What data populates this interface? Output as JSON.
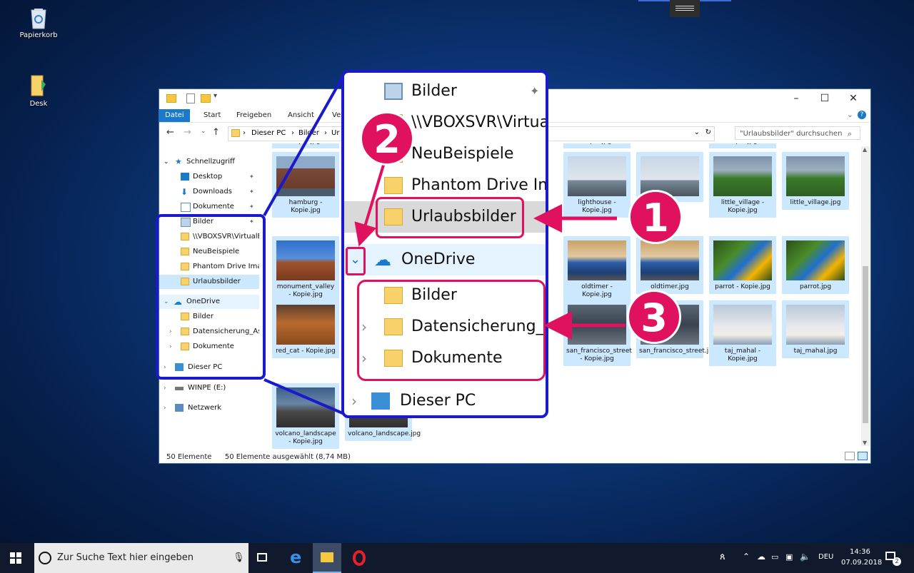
{
  "desktop": {
    "icons": [
      {
        "label": "Papierkorb"
      },
      {
        "label": "Desk"
      }
    ]
  },
  "explorer": {
    "ribbon_tabs": [
      "Datei",
      "Start",
      "Freigeben",
      "Ansicht",
      "Ve"
    ],
    "breadcrumb": [
      "Dieser PC",
      "Bilder",
      "Ur"
    ],
    "search_placeholder": "\"Urlaubsbilder\" durchsuchen",
    "nav": [
      {
        "label": "Schnellzugriff",
        "icon": "star-icon"
      },
      {
        "label": "Desktop",
        "icon": "desktop-icon",
        "pinned": true
      },
      {
        "label": "Downloads",
        "icon": "download-arrow-icon",
        "pinned": true
      },
      {
        "label": "Dokumente",
        "icon": "document-icon",
        "pinned": true
      },
      {
        "label": "Bilder",
        "icon": "pictures-icon",
        "pinned": true
      },
      {
        "label": "\\\\VBOXSVR\\VirtualE",
        "icon": "network-folder-icon"
      },
      {
        "label": "NeuBeispiele",
        "icon": "folder-icon"
      },
      {
        "label": "Phantom Drive Ima",
        "icon": "folder-icon"
      },
      {
        "label": "Urlaubsbilder",
        "icon": "folder-icon",
        "selected": true
      },
      {
        "label": "OneDrive",
        "icon": "cloud-icon"
      },
      {
        "label": "Bilder",
        "icon": "folder-icon"
      },
      {
        "label": "Datensicherung_Ash",
        "icon": "folder-icon"
      },
      {
        "label": "Dokumente",
        "icon": "folder-icon"
      },
      {
        "label": "Dieser PC",
        "icon": "computer-icon"
      },
      {
        "label": "WINPE (E:)",
        "icon": "drive-icon"
      },
      {
        "label": "Netzwerk",
        "icon": "network-icon"
      }
    ],
    "thumbnails": [
      {
        "name": "Kopie.jpg",
        "pic": "partial"
      },
      {
        "name": "Kopie.jpg",
        "pic": "partial"
      },
      {
        "name": "Kopie.jpg",
        "pic": "partial"
      },
      {
        "name": "hamburg - Kopie.jpg",
        "pic": "city"
      },
      {
        "name": "lighthouse - Kopie.jpg",
        "pic": "lighthouse"
      },
      {
        "name": "",
        "pic": "lighthouse"
      },
      {
        "name": "little_village - Kopie.jpg",
        "pic": "village"
      },
      {
        "name": "little_village.jpg",
        "pic": "village"
      },
      {
        "name": "monument_valley - Kopie.jpg",
        "pic": "desert"
      },
      {
        "name": "oldtimer - Kopie.jpg",
        "pic": "car"
      },
      {
        "name": "oldtimer.jpg",
        "pic": "car"
      },
      {
        "name": "parrot - Kopie.jpg",
        "pic": "parrot"
      },
      {
        "name": "parrot.jpg",
        "pic": "parrot"
      },
      {
        "name": "red_cat - Kopie.jpg",
        "pic": "cat"
      },
      {
        "name": "san_francisco_street - Kopie.jpg",
        "pic": "street"
      },
      {
        "name": "san_francisco_street.jpg",
        "pic": "street"
      },
      {
        "name": "taj_mahal - Kopie.jpg",
        "pic": "taj"
      },
      {
        "name": "taj_mahal.jpg",
        "pic": "taj"
      },
      {
        "name": "volcano_landscape - Kopie.jpg",
        "pic": "volcano"
      },
      {
        "name": "volcano_landscape.jpg",
        "pic": "volcano"
      }
    ],
    "status_count": "50 Elemente",
    "status_selected": "50 Elemente ausgewählt (8,74 MB)"
  },
  "zoom_panel": {
    "items": [
      {
        "label": "Bilder",
        "icon": "pictures-icon"
      },
      {
        "label": "\\\\VBOXSVR\\VirtualE",
        "icon": "network-folder-icon"
      },
      {
        "label": "NeuBeispiele",
        "icon": "folder-icon"
      },
      {
        "label": "Phantom Drive Ima",
        "icon": "folder-icon"
      },
      {
        "label": "Urlaubsbilder",
        "icon": "folder-icon"
      },
      {
        "label": "OneDrive",
        "icon": "cloud-icon"
      },
      {
        "label": "Bilder",
        "icon": "folder-icon"
      },
      {
        "label": "Datensicherung_Ash",
        "icon": "folder-icon"
      },
      {
        "label": "Dokumente",
        "icon": "folder-icon"
      },
      {
        "label": "Dieser PC",
        "icon": "computer-icon"
      }
    ]
  },
  "callouts": {
    "one": "1",
    "two": "2",
    "three": "3"
  },
  "taskbar": {
    "search_placeholder": "Zur Suche Text hier eingeben",
    "language": "DEU",
    "time": "14:36",
    "date": "07.09.2018",
    "notification_count": "2"
  },
  "colors": {
    "accent": "#1979ca",
    "callout": "#e0115f",
    "zoom_border": "#1a1acc",
    "selection": "#cce8ff"
  }
}
